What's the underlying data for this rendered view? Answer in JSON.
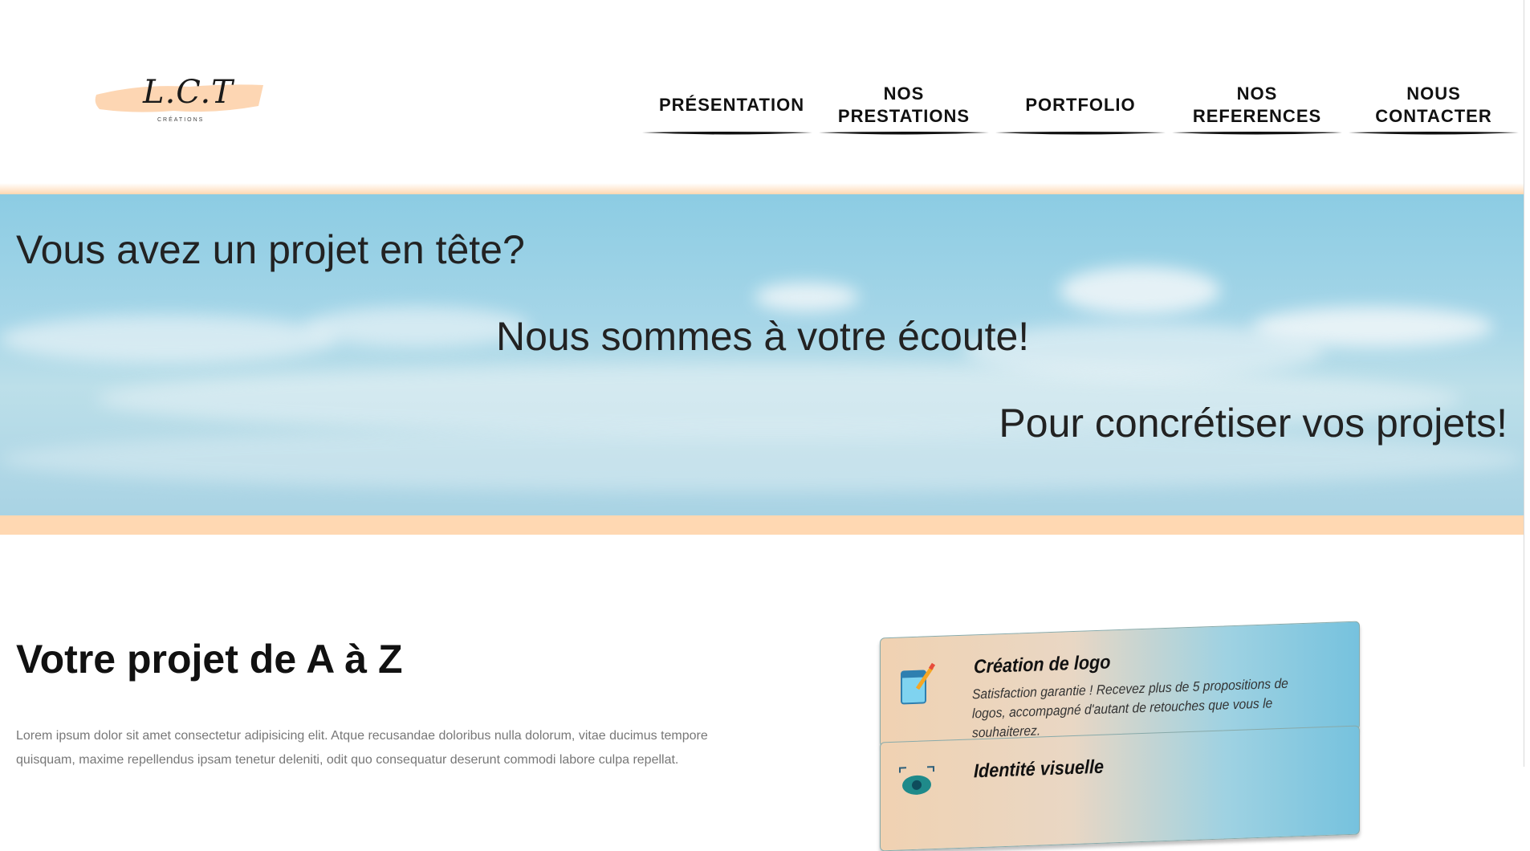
{
  "logo": {
    "text": "L.C.T",
    "subtitle": "CRÉATIONS"
  },
  "nav": {
    "items": [
      {
        "label": "PRÉSENTATION"
      },
      {
        "label": "NOS PRESTATIONS"
      },
      {
        "label": "PORTFOLIO"
      },
      {
        "label": "NOS REFERENCES"
      },
      {
        "label": "NOUS CONTACTER"
      }
    ]
  },
  "hero": {
    "line1": "Vous avez un projet en tête?",
    "line2": "Nous sommes à votre écoute!",
    "line3": "Pour concrétiser vos projets!"
  },
  "section": {
    "title": "Votre projet de A à Z",
    "text": "Lorem ipsum dolor sit amet consectetur adipisicing elit. Atque recusandae doloribus nulla dolorum, vitae ducimus tempore quisquam, maxime repellendus ipsam tenetur deleniti, odit quo consequatur deserunt commodi labore culpa repellat."
  },
  "cards": [
    {
      "title": "Création de logo",
      "description": "Satisfaction garantie ! Recevez plus de 5 propositions de logos, accompagné d'autant de retouches que vous le souhaiterez.",
      "icon": "notepad-pencil-icon"
    },
    {
      "title": "Identité visuelle",
      "description": "",
      "icon": "eye-icon"
    }
  ],
  "colors": {
    "accent": "#ffd8b2",
    "sky": "#8ccce3",
    "text": "#222222"
  }
}
